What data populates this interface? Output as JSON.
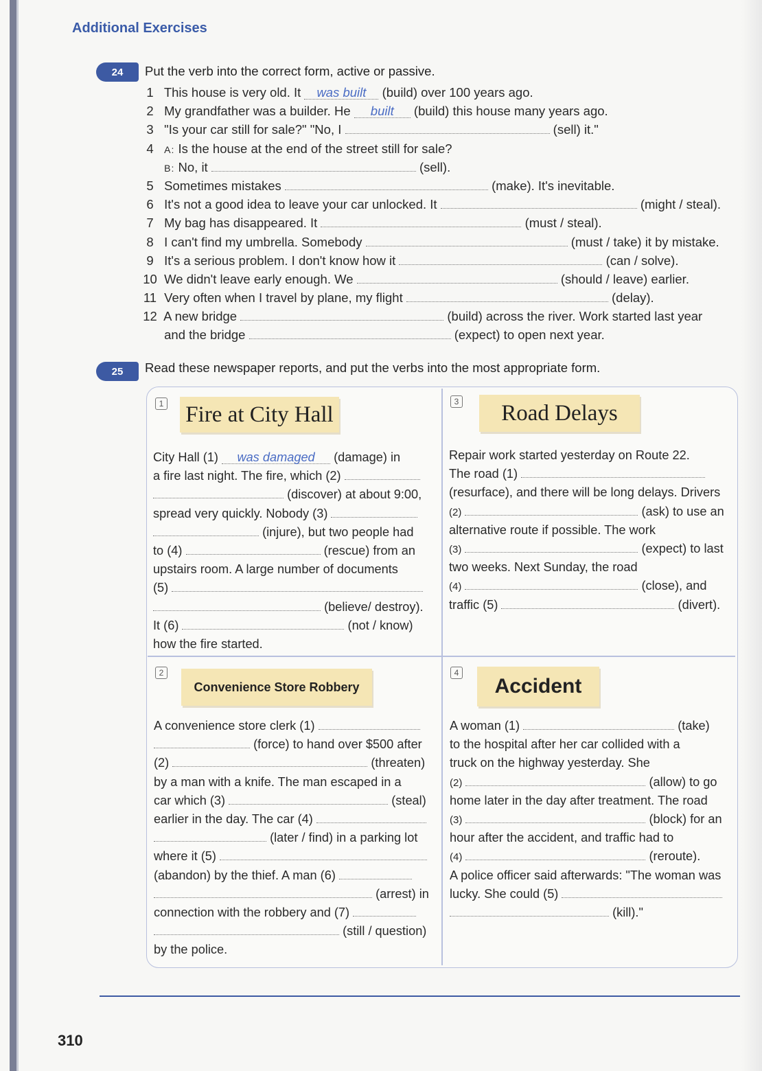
{
  "section_title": "Additional Exercises",
  "page_number": "310",
  "ex24": {
    "number": "24",
    "instruction": "Put the verb into the correct form, active or passive.",
    "items": [
      {
        "n": "1",
        "pre": "This house is very old.  It",
        "ans": "was built",
        "post": "(build) over 100 years ago."
      },
      {
        "n": "2",
        "pre": "My grandfather was a builder.  He",
        "ans": "built",
        "post": "(build) this house many years ago."
      },
      {
        "n": "3",
        "pre": "\"Is your car still for sale?\"    \"No, I",
        "post": "(sell) it.\""
      },
      {
        "n": "4",
        "speaker": "A:",
        "pre": "Is the house at the end of the street still for sale?"
      },
      {
        "speaker": "B:",
        "pre": "No, it",
        "post": "(sell)."
      },
      {
        "n": "5",
        "pre": "Sometimes mistakes",
        "post": "(make).  It's inevitable."
      },
      {
        "n": "6",
        "pre": "It's not a good idea to leave your car unlocked.  It",
        "post": "(might / steal)."
      },
      {
        "n": "7",
        "pre": "My bag has disappeared.  It",
        "post": "(must / steal)."
      },
      {
        "n": "8",
        "pre": "I can't find my umbrella.  Somebody",
        "post": "(must / take) it by mistake."
      },
      {
        "n": "9",
        "pre": "It's a serious problem.  I don't know how it",
        "post": "(can / solve)."
      },
      {
        "n": "10",
        "pre": "We didn't leave early enough.  We",
        "post": "(should / leave) earlier."
      },
      {
        "n": "11",
        "pre": "Very often when I travel by plane, my flight",
        "post": "(delay)."
      },
      {
        "n": "12",
        "pre": "A new bridge",
        "post": "(build) across the river.  Work started last year"
      },
      {
        "pre": "and the bridge",
        "post": "(expect) to open next year."
      }
    ]
  },
  "ex25": {
    "number": "25",
    "instruction": "Read these newspaper reports, and put the verbs into the most appropriate form.",
    "stories": {
      "s1": {
        "num": "1",
        "headline": "Fire at City Hall",
        "lines": [
          {
            "pre": "City Hall (1)",
            "ans": "was damaged",
            "post": "(damage) in"
          },
          {
            "pre": "a fire last night.  The fire, which (2)"
          },
          {
            "post": "(discover) at about 9:00,"
          },
          {
            "pre": "spread very quickly.  Nobody (3)"
          },
          {
            "post": "(injure), but two people had"
          },
          {
            "pre": "to (4)",
            "post": "(rescue) from an"
          },
          {
            "pre": "upstairs room.  A large number of documents"
          },
          {
            "pre": "(5)"
          },
          {
            "post": "(believe/ destroy)."
          },
          {
            "pre": "It (6)",
            "post": "(not / know)"
          },
          {
            "pre": "how the fire started."
          }
        ]
      },
      "s2": {
        "num": "2",
        "headline": "Convenience Store Robbery",
        "lines": [
          {
            "pre": "A convenience store clerk (1)"
          },
          {
            "post": "(force) to hand over $500 after"
          },
          {
            "pre": "(2)",
            "post": "(threaten)"
          },
          {
            "pre": "by a man with a knife.  The man escaped in a"
          },
          {
            "pre": "car which (3)",
            "post": "(steal)"
          },
          {
            "pre": "earlier in the day.  The car (4)"
          },
          {
            "post": "(later / find) in a parking lot"
          },
          {
            "pre": "where it (5)"
          },
          {
            "pre": "(abandon) by the thief.  A man (6)"
          },
          {
            "post": "(arrest) in"
          },
          {
            "pre": "connection with the robbery and (7)"
          },
          {
            "post": "(still / question)"
          },
          {
            "pre": "by the police."
          }
        ]
      },
      "s3": {
        "num": "3",
        "headline": "Road Delays",
        "lines": [
          {
            "pre": "Repair work started yesterday on Route 22."
          },
          {
            "pre": "The road (1)"
          },
          {
            "pre": "(resurface), and there will be long delays.  Drivers"
          },
          {
            "pre": "(2)",
            "post": "(ask) to use an"
          },
          {
            "pre": "alternative route if possible.  The work"
          },
          {
            "pre": "(3)",
            "post": "(expect) to last"
          },
          {
            "pre": "two weeks.  Next Sunday, the road"
          },
          {
            "pre": "(4)",
            "post": "(close), and"
          },
          {
            "pre": "traffic (5)",
            "post": "(divert)."
          }
        ]
      },
      "s4": {
        "num": "4",
        "headline": "Accident",
        "lines": [
          {
            "pre": "A woman (1)",
            "post": "(take)"
          },
          {
            "pre": "to the hospital after her car collided with a"
          },
          {
            "pre": "truck on the highway yesterday.  She"
          },
          {
            "pre": "(2)",
            "post": "(allow) to go"
          },
          {
            "pre": "home later in the day after treatment.  The road"
          },
          {
            "pre": "(3)",
            "post": "(block) for an"
          },
          {
            "pre": "hour after the accident, and traffic had to"
          },
          {
            "pre": "(4)",
            "post": "(reroute)."
          },
          {
            "pre": "A police officer said afterwards: \"The woman was"
          },
          {
            "pre": "lucky.  She could (5)"
          },
          {
            "post": "(kill).\""
          }
        ]
      }
    }
  }
}
